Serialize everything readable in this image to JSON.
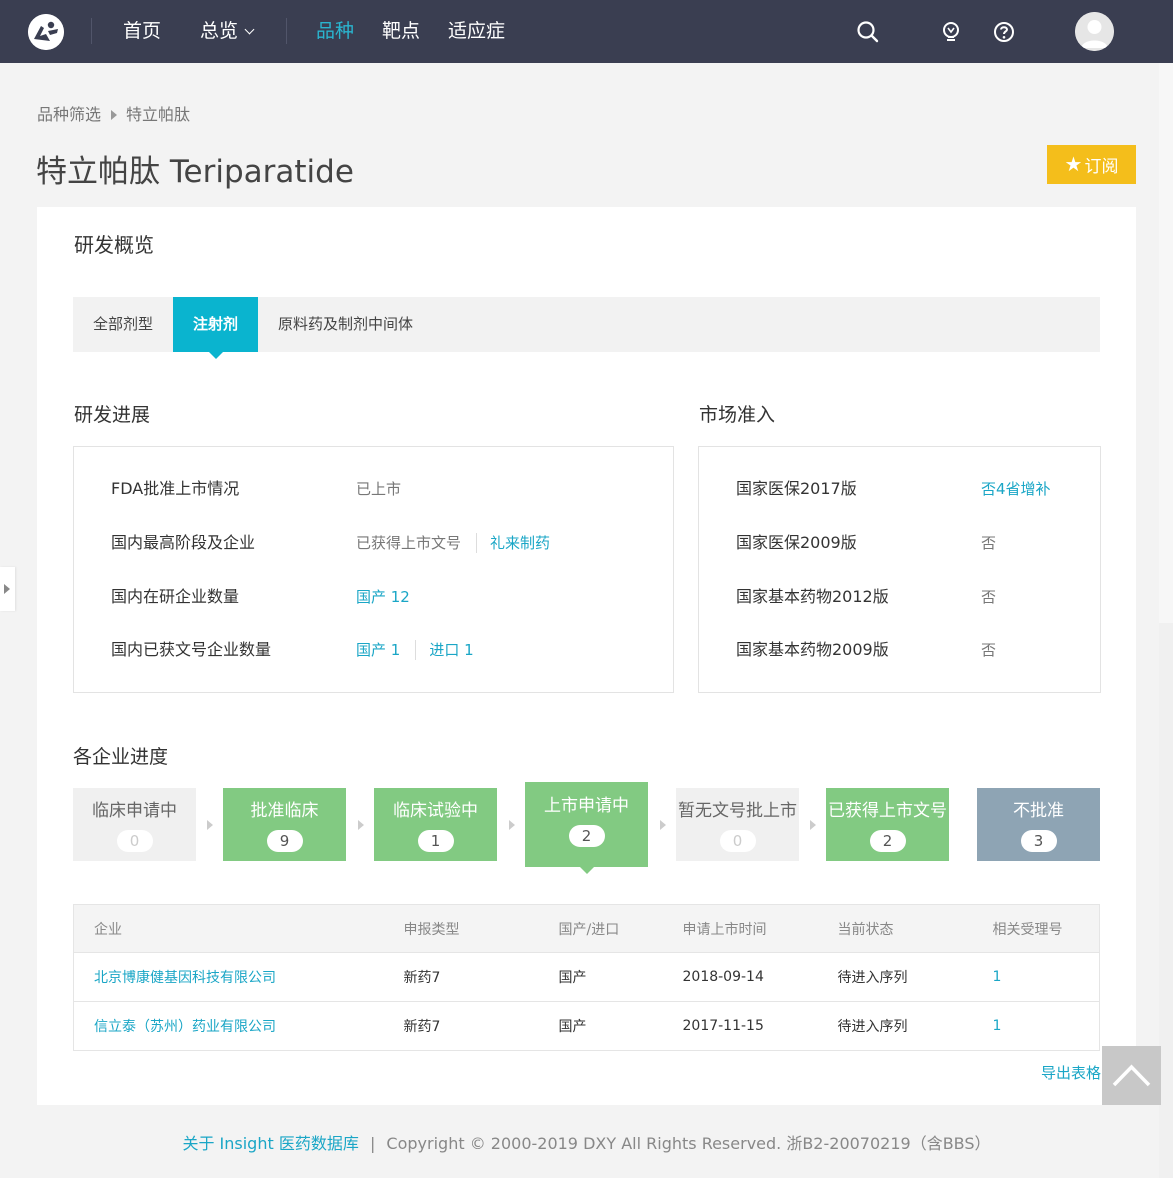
{
  "nav": {
    "items": [
      {
        "label": "首页"
      },
      {
        "label": "总览"
      },
      {
        "label": "品种"
      },
      {
        "label": "靶点"
      },
      {
        "label": "适应症"
      }
    ]
  },
  "breadcrumb": {
    "root": "品种筛选",
    "current": "特立帕肽"
  },
  "page": {
    "title": "特立帕肽 Teriparatide",
    "subscribe_label": "订阅"
  },
  "rd_overview": {
    "title": "研发概览",
    "tabs": [
      {
        "label": "全部剂型"
      },
      {
        "label": "注射剂"
      },
      {
        "label": "原料药及制剂中间体"
      }
    ]
  },
  "progress": {
    "title": "研发进展",
    "rows": [
      {
        "label": "FDA批准上市情况",
        "value": "已上市"
      },
      {
        "label": "国内最高阶段及企业",
        "value": "已获得上市文号",
        "company": "礼来制药"
      },
      {
        "label": "国内在研企业数量",
        "value": "国产 12"
      },
      {
        "label": "国内已获文号企业数量",
        "domestic": "国产 1",
        "imported": "进口 1"
      }
    ]
  },
  "market": {
    "title": "市场准入",
    "rows": [
      {
        "label": "国家医保2017版",
        "value": "否4省增补"
      },
      {
        "label": "国家医保2009版",
        "value": "否"
      },
      {
        "label": "国家基本药物2012版",
        "value": "否"
      },
      {
        "label": "国家基本药物2009版",
        "value": "否"
      }
    ]
  },
  "company_progress": {
    "title": "各企业进度",
    "steps": [
      {
        "label": "临床申请中",
        "count": "0"
      },
      {
        "label": "批准临床",
        "count": "9"
      },
      {
        "label": "临床试验中",
        "count": "1"
      },
      {
        "label": "上市申请中",
        "count": "2"
      },
      {
        "label": "暂无文号批上市",
        "count": "0"
      },
      {
        "label": "已获得上市文号",
        "count": "2"
      },
      {
        "label": "不批准",
        "count": "3"
      }
    ],
    "colors": {
      "grey": "#f0f0f0",
      "green": "#82ca82",
      "slate": "#8ea4b4"
    }
  },
  "table": {
    "headers": [
      "企业",
      "申报类型",
      "国产/进口",
      "申请上市时间",
      "当前状态",
      "相关受理号"
    ],
    "rows": [
      [
        "北京博康健基因科技有限公司",
        "新药7",
        "国产",
        "2018-09-14",
        "待进入序列",
        "1"
      ],
      [
        "信立泰（苏州）药业有限公司",
        "新药7",
        "国产",
        "2017-11-15",
        "待进入序列",
        "1"
      ]
    ],
    "export_label": "导出表格"
  },
  "footer": {
    "about": "关于 Insight 医药数据库",
    "separator": "|",
    "copyright": "Copyright © 2000-2019 DXY All Rights Reserved. 浙B2-20070219（含BBS）"
  },
  "icons": {
    "logo": "dxy-logo-icon",
    "search": "search-icon",
    "idea": "lightbulb-icon",
    "help": "help-icon",
    "avatar": "user-avatar-icon",
    "back_to_top": "chevron-up-icon"
  },
  "colors": {
    "accent": "#0ab4cf",
    "link": "#1aa6c6",
    "topbar": "#3a3e51",
    "subscribe": "#f4be1b"
  }
}
